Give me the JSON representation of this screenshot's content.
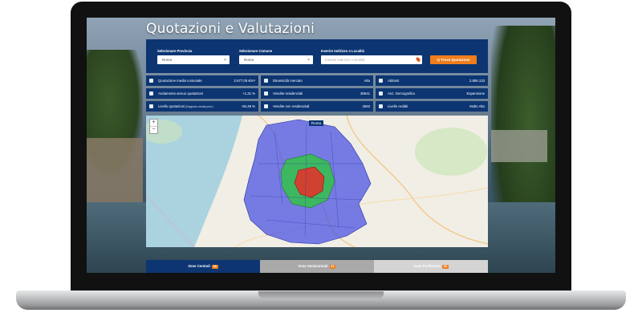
{
  "app": {
    "title": "Quotazioni e Valutazioni"
  },
  "search": {
    "province_label": "Selezionare Provincia",
    "province_value": "Roma",
    "comune_label": "Selezionare Comune",
    "comune_value": "Roma",
    "address_label": "Inserire Indirizzo o Località",
    "address_placeholder": "Inserire indirizzo o località",
    "button_label": "Q Trova Quotazioni"
  },
  "stats": [
    {
      "label": "Quotazione media comunale",
      "value": "2.677,05 €/m²",
      "icon": "building-icon"
    },
    {
      "label": "Dinamicità mercato",
      "value": "Alta",
      "icon": "flame-icon"
    },
    {
      "label": "Abitanti",
      "value": "2.856.133",
      "icon": "people-icon"
    },
    {
      "label": "Andamento annuo quotazioni",
      "value": "+1,31 %",
      "icon": "trend-icon"
    },
    {
      "label": "Vendite residenziali",
      "value": "38641",
      "icon": "key-icon"
    },
    {
      "label": "Anz. Demografico",
      "value": "Espansione",
      "icon": "chart-icon"
    },
    {
      "label": "Livello quotazioni",
      "sub": "(Rapporto media prov.)",
      "value": "-50,49 %",
      "icon": "bookmark-icon"
    },
    {
      "label": "Vendite non residenziali",
      "value": "4593",
      "icon": "shop-icon"
    },
    {
      "label": "Livello redditi",
      "value": "Molto Alto",
      "icon": "wallet-icon"
    }
  ],
  "map": {
    "label": "Roma",
    "zoom_in": "+",
    "zoom_out": "−"
  },
  "tabs": [
    {
      "label": "Zone Centrali",
      "badge": "58",
      "active": true
    },
    {
      "label": "Zone Semicentrali",
      "badge": "61",
      "active": false
    },
    {
      "label": "Zone Periferiche",
      "badge": "98",
      "active": false
    }
  ],
  "colors": {
    "primary": "#0c3572",
    "accent": "#f07d1b",
    "center_zone": "#e0342b",
    "semi_zone": "#35c24a",
    "outer_zone": "#4b54e0"
  }
}
